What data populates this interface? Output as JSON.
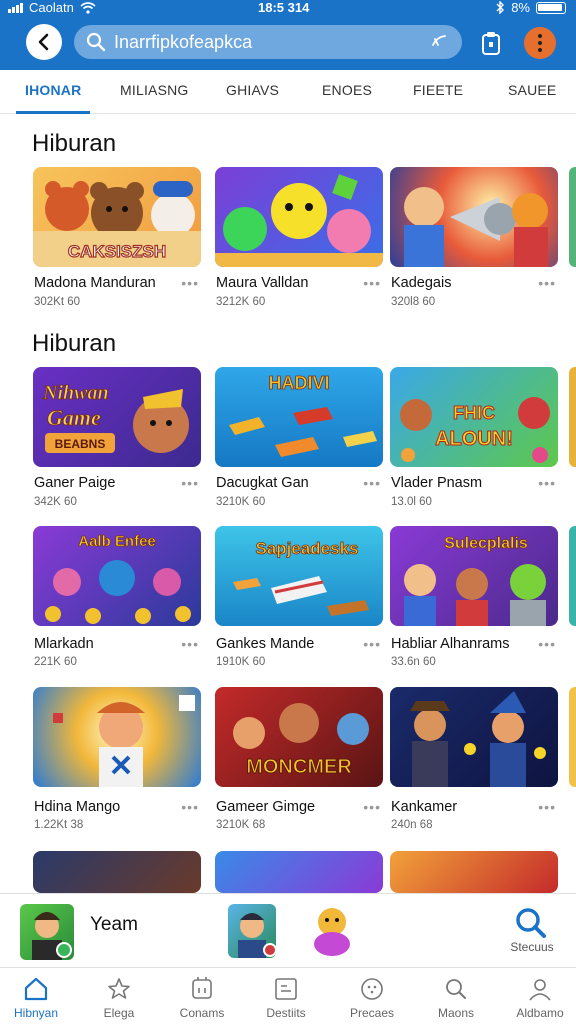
{
  "status_bar": {
    "carrier": "Caolatn",
    "time": "18:5 314",
    "battery": "8%"
  },
  "search": {
    "placeholder": "Inarrfipkofeapkca"
  },
  "tabs": [
    {
      "label": "IHONAR",
      "active": true
    },
    {
      "label": "MILIASNG"
    },
    {
      "label": "GHIAVS"
    },
    {
      "label": "ENOES"
    },
    {
      "label": "FIEETE"
    },
    {
      "label": "SAUEE"
    }
  ],
  "sections": [
    {
      "title": "Hiburan",
      "cards": [
        {
          "name": "Madona Manduran",
          "meta": "302Kt 60",
          "art_text": "CAKSISZSH"
        },
        {
          "name": "Maura Valldan",
          "meta": "3212K 60"
        },
        {
          "name": "Kadegais",
          "meta": "320l8 60"
        }
      ]
    },
    {
      "title": "Hiburan",
      "cards": [
        {
          "name": "Ganer Paige",
          "meta": "342K 60",
          "art_text": "Nihwan Game BEABNS"
        },
        {
          "name": "Dacugkat Gan",
          "meta": "3210K 60",
          "art_text": "HADIVI"
        },
        {
          "name": "Vlader Pnasm",
          "meta": "13.0l 60",
          "art_text": "FHIC ALOUN!"
        }
      ]
    },
    {
      "cards": [
        {
          "name": "Mlarkadn",
          "meta": "221K 60",
          "art_text": "Aalb Enfee"
        },
        {
          "name": "Gankes Mande",
          "meta": "1910K 60",
          "art_text": "Sapjeadesks"
        },
        {
          "name": "Habliar Alhanrams",
          "meta": "33.6n 60",
          "art_text": "Sulecplalis"
        }
      ]
    },
    {
      "cards": [
        {
          "name": "Hdina Mango",
          "meta": "1.22Kt 38"
        },
        {
          "name": "Gameer Gimge",
          "meta": "3210K 68",
          "art_text": "MONCMER"
        },
        {
          "name": "Kankamer",
          "meta": "240n 68"
        }
      ]
    }
  ],
  "mini_player": {
    "title": "Yeam",
    "search_label": "Stecuus"
  },
  "bottom_nav": [
    {
      "label": "Hibnyan",
      "icon": "home-icon",
      "active": true
    },
    {
      "label": "Elega",
      "icon": "star-icon"
    },
    {
      "label": "Conams",
      "icon": "apps-icon"
    },
    {
      "label": "Destiits",
      "icon": "list-icon"
    },
    {
      "label": "Precaes",
      "icon": "circle-icon"
    },
    {
      "label": "Maons",
      "icon": "search-icon"
    },
    {
      "label": "Aldbamo",
      "icon": "person-icon"
    }
  ],
  "colors": {
    "primary": "#1a73c7",
    "search_bg": "#6fa7df",
    "menu_button": "#e76f2e"
  }
}
